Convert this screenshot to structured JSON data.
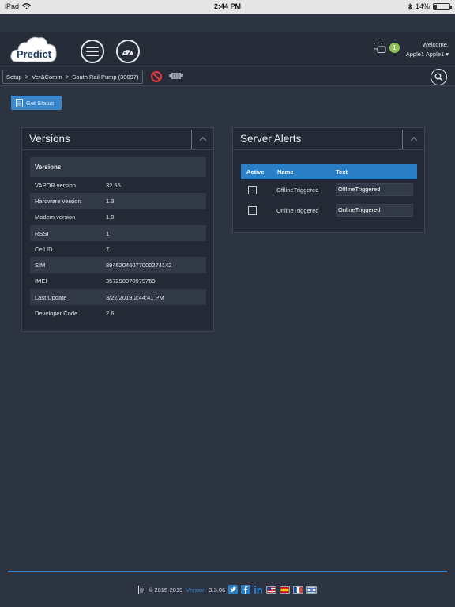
{
  "status_bar": {
    "device": "iPad",
    "time": "2:44 PM",
    "battery": "14%"
  },
  "header": {
    "logo_text": "Predict",
    "notification_count": "1",
    "welcome_label": "Welcome,",
    "user_name": "Apple1 Apple1"
  },
  "breadcrumb": {
    "items": [
      "Setup",
      "Ver&Comm",
      "South Rail Pump (30097)"
    ]
  },
  "toolbar": {
    "get_status_label": "Get Status"
  },
  "versions": {
    "title": "Versions",
    "table_header": "Versions",
    "rows": [
      {
        "label": "VAPOR version",
        "value": "32.55"
      },
      {
        "label": "Hardware version",
        "value": "1.3"
      },
      {
        "label": "Modem version",
        "value": "1.0"
      },
      {
        "label": "RSSI",
        "value": "1"
      },
      {
        "label": "Cell ID",
        "value": "7"
      },
      {
        "label": "SIM",
        "value": "89462046077000274142"
      },
      {
        "label": "IMEI",
        "value": "357298070979769"
      },
      {
        "label": "Last Update",
        "value": "3/22/2019 2:44:41 PM"
      },
      {
        "label": "Developer Code",
        "value": "2.6"
      }
    ]
  },
  "server_alerts": {
    "title": "Server Alerts",
    "columns": [
      "Active",
      "Name",
      "Text"
    ],
    "rows": [
      {
        "name": "OfflineTriggered",
        "text": "OfflineTriggered"
      },
      {
        "name": "OnlineTriggered",
        "text": "OnlineTriggered"
      }
    ]
  },
  "footer": {
    "copyright": "© 2015-2019",
    "version_label": "Version",
    "version": "3.3.06"
  },
  "colors": {
    "accent": "#3a86c8",
    "background": "#2c3442",
    "panel": "#232a35",
    "badge": "#8cc152"
  }
}
